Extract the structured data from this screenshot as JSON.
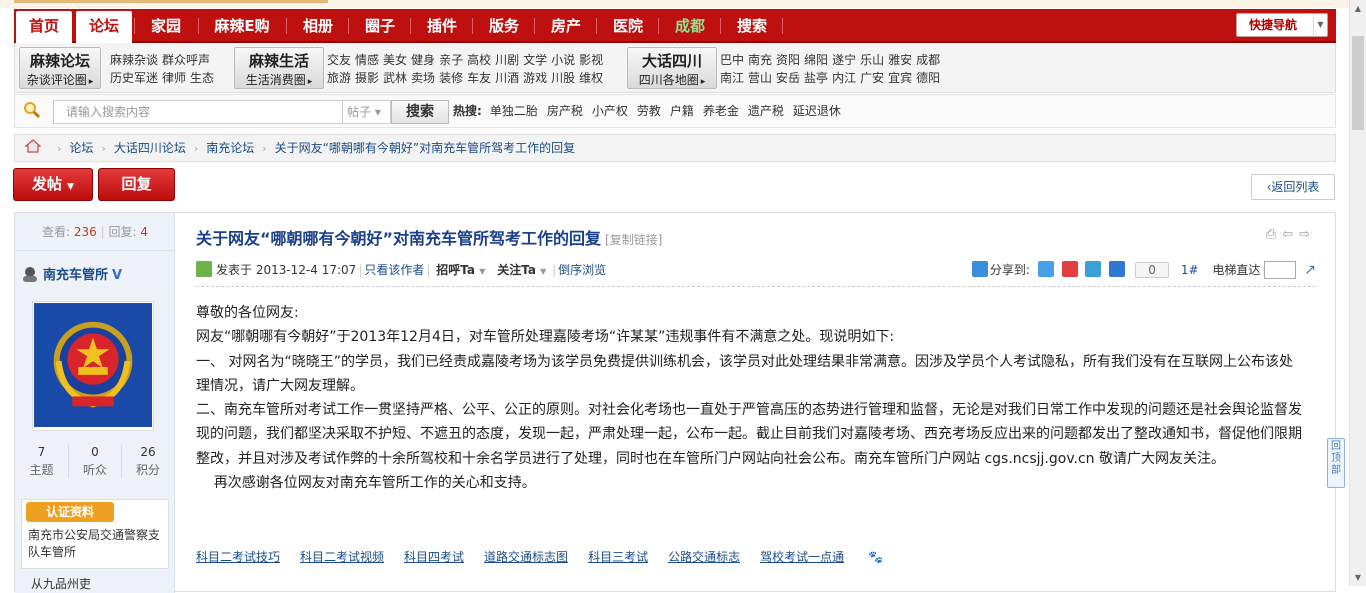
{
  "nav": {
    "items": [
      "首页",
      "论坛",
      "家园",
      "麻辣E购",
      "相册",
      "圈子",
      "插件",
      "版务",
      "房产",
      "医院",
      "成都",
      "搜索"
    ],
    "active_index": 1,
    "quick_nav": "快捷导航"
  },
  "subnav": {
    "groups": [
      {
        "title": "麻辣论坛",
        "sub": "杂谈评论圈",
        "links": [
          "麻辣杂谈",
          "群众呼声",
          "历史军迷",
          "律师",
          "生态"
        ]
      },
      {
        "title": "麻辣生活",
        "sub": "生活消费圈",
        "links": [
          "交友",
          "情感",
          "美女",
          "健身",
          "亲子",
          "高校",
          "川剧",
          "文学",
          "小说",
          "影视",
          "旅游",
          "摄影",
          "武林",
          "卖场",
          "装修",
          "车友",
          "川酒",
          "游戏",
          "川股",
          "维权"
        ]
      },
      {
        "title": "大话四川",
        "sub": "四川各地圈",
        "links": [
          "巴中",
          "南充",
          "资阳",
          "绵阳",
          "遂宁",
          "乐山",
          "雅安",
          "成都",
          "南江",
          "营山",
          "安岳",
          "盐亭",
          "内江",
          "广安",
          "宜宾",
          "德阳"
        ]
      }
    ]
  },
  "search": {
    "placeholder": "请输入搜索内容",
    "scope": "帖子",
    "button": "搜索",
    "hot_label": "热搜:",
    "hot": [
      "单独二胎",
      "房产税",
      "小产权",
      "劳教",
      "户籍",
      "养老金",
      "遗产税",
      "延迟退休"
    ]
  },
  "breadcrumb": [
    "论坛",
    "大话四川论坛",
    "南充论坛",
    "关于网友“哪朝哪有今朝好”对南充车管所驾考工作的回复"
  ],
  "actions": {
    "post": "发帖",
    "reply": "回复",
    "back": "返回列表"
  },
  "thread": {
    "views_label": "查看:",
    "views": "236",
    "replies_label": "回复:",
    "replies": "4",
    "title": "关于网友“哪朝哪有今朝好”对南充车管所驾考工作的回复",
    "copy_link": "[复制链接]"
  },
  "author": {
    "name": "南充车管所",
    "verified": "V",
    "stats": [
      {
        "num": "7",
        "label": "主题"
      },
      {
        "num": "0",
        "label": "听众"
      },
      {
        "num": "26",
        "label": "积分"
      }
    ],
    "cert_button": "认证资料",
    "cert_text": "南充市公安局交通警察支队车管所",
    "rank": "从九品州吏"
  },
  "meta": {
    "posted": "发表于 2013-12-4 17:07",
    "only_author": "只看该作者",
    "greet": "招呼Ta",
    "follow": "关注Ta",
    "reverse": "倒序浏览",
    "share_label": "分享到:",
    "share_count": "0",
    "floor": "1#",
    "elevator": "电梯直达"
  },
  "content": {
    "paragraphs": [
      "尊敬的各位网友:",
      "网友“哪朝哪有今朝好”于2013年12月4日，对车管所处理嘉陵考场“许某某”违规事件有不满意之处。现说明如下:",
      "一、 对网名为“晓晓王”的学员，我们已经责成嘉陵考场为该学员免费提供训练机会，该学员对此处理结果非常满意。因涉及学员个人考试隐私，所有我们没有在互联网上公布该处理情况，请广大网友理解。",
      "二、南充车管所对考试工作一贯坚持严格、公平、公正的原则。对社会化考场也一直处于严管高压的态势进行管理和监督，无论是对我们日常工作中发现的问题还是社会舆论监督发现的问题，我们都坚决采取不护短、不遮丑的态度，发现一起，严肃处理一起，公布一起。截止目前我们对嘉陵考场、西充考场反应出来的问题都发出了整改通知书，督促他们限期整改，并且对涉及考试作弊的十余所驾校和十余名学员进行了处理，同时也在车管所门户网站向社会公布。南充车管所门户网站 cgs.ncsjj.gov.cn  敬请广大网友关注。",
      "    再次感谢各位网友对南充车管所工作的关心和支持。"
    ]
  },
  "ad_links": [
    "科目二考试技巧",
    "科目二考试视频",
    "科目四考试",
    "道路交通标志图",
    "科目三考试",
    "公路交通标志",
    "驾校考试一点通"
  ],
  "side_tab": "回顶部"
}
